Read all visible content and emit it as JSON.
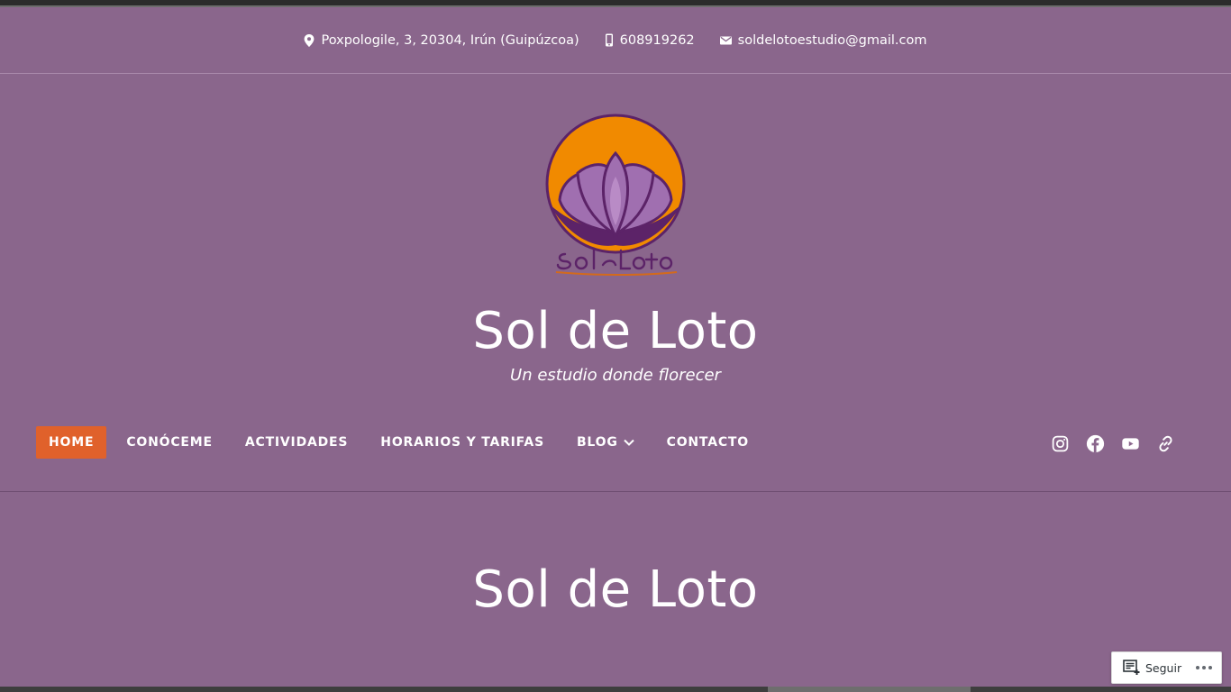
{
  "contact": {
    "address": "Poxpologile, 3, 20304, Irún (Guipúzcoa)",
    "phone": "608919262",
    "email": "soldelotoestudio@gmail.com"
  },
  "logo": {
    "wordmark": "Sol de Loto",
    "colors": {
      "sun": "#f18a00",
      "lotus": "#a06fb0",
      "outline": "#5c2368"
    }
  },
  "site": {
    "title": "Sol de Loto",
    "tagline": "Un estudio donde florecer"
  },
  "nav": {
    "items": [
      {
        "label": "HOME",
        "active": true
      },
      {
        "label": "CONÓCEME"
      },
      {
        "label": "ACTIVIDADES"
      },
      {
        "label": "HORARIOS Y TARIFAS"
      },
      {
        "label": "BLOG",
        "has_dropdown": true
      },
      {
        "label": "CONTACTO"
      }
    ]
  },
  "social": {
    "icons": [
      "instagram-icon",
      "facebook-icon",
      "youtube-icon",
      "link-icon"
    ]
  },
  "page": {
    "title": "Sol de Loto"
  },
  "follow_widget": {
    "label": "Seguir"
  },
  "colors": {
    "background": "#8a668c",
    "accent": "#e0612b",
    "text": "#ffffff"
  }
}
